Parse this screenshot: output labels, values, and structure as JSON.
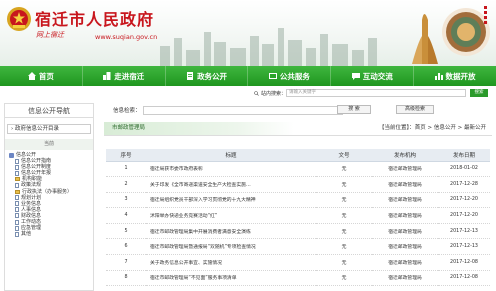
{
  "header": {
    "site_title": "宿迁市人民政府",
    "slogan": "网上宿迁",
    "url": "www.suqian.gov.cn",
    "seal_text": "中国·宿迁",
    "colors": {
      "brand_red": "#c8161d",
      "nav_green": "#2ba52b"
    }
  },
  "nav": {
    "items": [
      {
        "label": "首页",
        "icon": "home-icon"
      },
      {
        "label": "走进宿迁",
        "icon": "city-icon"
      },
      {
        "label": "政务公开",
        "icon": "document-icon"
      },
      {
        "label": "公共服务",
        "icon": "service-icon"
      },
      {
        "label": "互动交流",
        "icon": "chat-icon"
      },
      {
        "label": "数据开放",
        "icon": "data-icon"
      }
    ]
  },
  "site_search": {
    "label": "站内搜索：",
    "placeholder": "请输入关键字",
    "button": "搜索"
  },
  "sidebar": {
    "title": "信息公开导航",
    "subnav": "› 政府信息公开目录",
    "current": "当前",
    "tree": [
      {
        "label": "信息公开",
        "level": 0,
        "icon": "root"
      },
      {
        "label": "信息公开指南",
        "level": 1,
        "icon": "doc"
      },
      {
        "label": "信息公开制度",
        "level": 1,
        "icon": "doc"
      },
      {
        "label": "信息公开年报",
        "level": 1,
        "icon": "doc"
      },
      {
        "label": "机构职能",
        "level": 1,
        "icon": "folder"
      },
      {
        "label": "政策法规",
        "level": 2,
        "icon": "doc"
      },
      {
        "label": "行政执法（办事服务）",
        "level": 2,
        "icon": "folder"
      },
      {
        "label": "规划计划",
        "level": 2,
        "icon": "doc"
      },
      {
        "label": "业务信息",
        "level": 2,
        "icon": "doc"
      },
      {
        "label": "人事信息",
        "level": 2,
        "icon": "doc"
      },
      {
        "label": "财政信息",
        "level": 2,
        "icon": "doc"
      },
      {
        "label": "工作动态",
        "level": 2,
        "icon": "doc"
      },
      {
        "label": "应急管理",
        "level": 2,
        "icon": "doc"
      },
      {
        "label": "其他",
        "level": 2,
        "icon": "doc"
      }
    ]
  },
  "main": {
    "info_search_label": "信息检索：",
    "search_button": "搜 索",
    "advanced_button": "高级检索",
    "section_title": "市邮政管理局",
    "breadcrumb": "【当前位置】：首页 > 信息公开 > 最新公开",
    "table": {
      "headers": [
        "序号",
        "标题",
        "文号",
        "发布机构",
        "发布日期"
      ],
      "rows": [
        [
          "1",
          "宿迁局获市委市政府表彰",
          "无",
          "宿迁邮政管理局",
          "2018-01-02"
        ],
        [
          "2",
          "关于印发《全市寄递渠道安全生产大检查实施…",
          "无",
          "宿迁邮政管理局",
          "2017-12-28"
        ],
        [
          "3",
          "宿迁局组织党员干部深入学习贯彻党的十九大精神",
          "无",
          "宿迁邮政管理局",
          "2017-12-20"
        ],
        [
          "4",
          "沭阳举办快递业务竞赛活动“红”",
          "无",
          "宿迁邮政管理局",
          "2017-12-20"
        ],
        [
          "5",
          "宿迁市邮政管理局集中开展消费者满意安全演练",
          "无",
          "宿迁邮政管理局",
          "2017-12-13"
        ],
        [
          "6",
          "宿迁市邮政管理局暨通报局“双随机”专项检查情况",
          "无",
          "宿迁邮政管理局",
          "2017-12-13"
        ],
        [
          "7",
          "关于政务信息公开事宜、实施情况",
          "无",
          "宿迁邮政管理局",
          "2017-12-08"
        ],
        [
          "8",
          "宿迁市邮政管理局“不见面”服务事项清单",
          "无",
          "宿迁邮政管理局",
          "2017-12-08"
        ]
      ]
    }
  }
}
